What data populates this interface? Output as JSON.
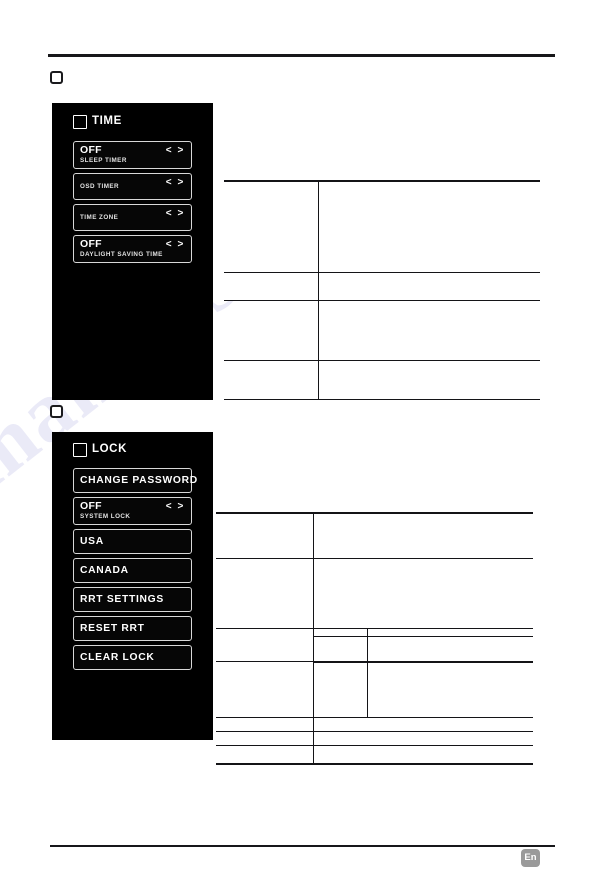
{
  "page": {
    "language_badge": "En"
  },
  "sections": [
    {
      "id": "time",
      "bullet_icon": "rounded-square-icon",
      "osd": {
        "title": "TIME",
        "items": [
          {
            "value": "OFF",
            "label": "SLEEP TIMER",
            "arrows": "< >",
            "has_arrows": true
          },
          {
            "value": "",
            "label": "OSD TIMER",
            "arrows": "< >",
            "has_arrows": true
          },
          {
            "value": "",
            "label": "TIME ZONE",
            "arrows": "< >",
            "has_arrows": true
          },
          {
            "value": "OFF",
            "label": "DAYLIGHT SAVING TIME",
            "arrows": "< >",
            "has_arrows": true
          }
        ]
      },
      "table": {
        "columns": 2,
        "rows": [
          {
            "cells": [
              "",
              ""
            ]
          },
          {
            "cells": [
              "",
              ""
            ]
          },
          {
            "cells": [
              "",
              ""
            ]
          },
          {
            "cells": [
              "",
              ""
            ]
          },
          {
            "cells": [
              "",
              ""
            ]
          }
        ]
      }
    },
    {
      "id": "lock",
      "bullet_icon": "rounded-square-icon",
      "osd": {
        "title": "LOCK",
        "items": [
          {
            "title": "CHANGE PASSWORD",
            "has_arrows": false
          },
          {
            "value": "OFF",
            "label": "SYSTEM LOCK",
            "arrows": "< >",
            "has_arrows": true
          },
          {
            "title": "USA",
            "has_arrows": false
          },
          {
            "title": "CANADA",
            "has_arrows": false
          },
          {
            "title": "RRT SETTINGS",
            "has_arrows": false
          },
          {
            "title": "RESET RRT",
            "has_arrows": false
          },
          {
            "title": "CLEAR LOCK",
            "has_arrows": false
          }
        ]
      },
      "table": {
        "columns": 3,
        "rows": [
          {
            "cells": [
              "",
              "",
              ""
            ]
          },
          {
            "cells": [
              "",
              "",
              ""
            ]
          },
          {
            "cells": [
              "",
              "",
              ""
            ]
          },
          {
            "cells": [
              "",
              "",
              ""
            ]
          },
          {
            "cells": [
              "",
              "",
              ""
            ]
          },
          {
            "cells": [
              "",
              "",
              ""
            ]
          },
          {
            "cells": [
              "",
              "",
              ""
            ]
          },
          {
            "cells": [
              "",
              "",
              ""
            ]
          },
          {
            "cells": [
              "",
              "",
              ""
            ]
          }
        ]
      }
    }
  ]
}
